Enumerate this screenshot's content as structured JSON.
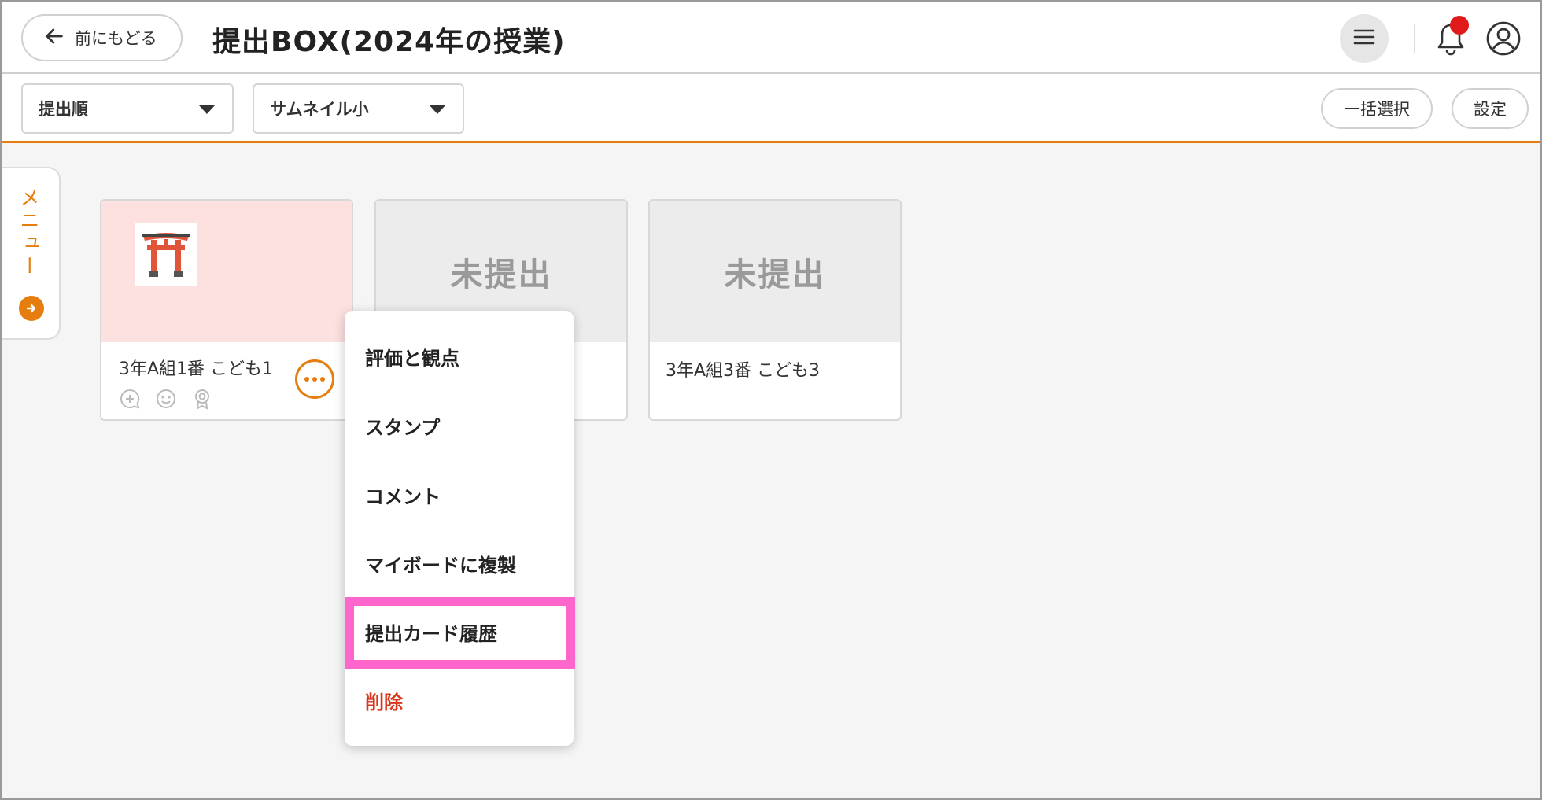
{
  "header": {
    "back_label": "前にもどる",
    "title": "提出BOX(2024年の授業)",
    "icons": [
      "arrow-left-icon",
      "hamburger-icon",
      "bell-icon",
      "account-icon"
    ]
  },
  "toolbar": {
    "sort_select": "提出順",
    "view_select": "サムネイル小",
    "bulk_select_label": "一括選択",
    "settings_label": "設定"
  },
  "side_menu": {
    "label": "メニュー"
  },
  "cards": [
    {
      "name": "3年A組1番 こども1",
      "status": "submitted",
      "thumbnail": "torii-icon"
    },
    {
      "name": "",
      "status": "未提出"
    },
    {
      "name": "3年A組3番 こども3",
      "status": "未提出"
    }
  ],
  "context_menu": {
    "items": [
      "評価と観点",
      "スタンプ",
      "コメント",
      "マイボードに複製",
      "提出カード履歴",
      "削除"
    ],
    "highlighted": "提出カード履歴"
  },
  "colors": {
    "accent": "#e67e0f",
    "danger": "#d9361c",
    "highlight": "#ff66cc",
    "submitted_bg": "#fde1e1"
  }
}
